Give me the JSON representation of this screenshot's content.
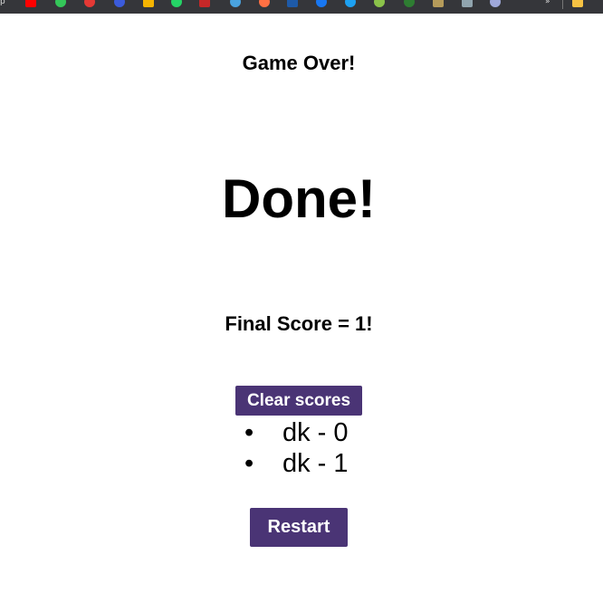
{
  "browser": {
    "bookmarks": [
      {
        "icon": "youtube-icon",
        "color": "#ff0000"
      },
      {
        "icon": "bookmark-green-icon",
        "color": "#34c759"
      },
      {
        "icon": "bookmark-red-icon",
        "color": "#e53935"
      },
      {
        "icon": "bookmark-blue-icon",
        "color": "#3b5bdb"
      },
      {
        "icon": "bookmark-yellow-icon",
        "color": "#f5b400"
      },
      {
        "icon": "whatsapp-icon",
        "color": "#25d366"
      },
      {
        "icon": "sk-icon",
        "color": "#c62828"
      },
      {
        "icon": "bookmark-lightblue-icon",
        "color": "#4aa3df"
      },
      {
        "icon": "bookmark-orange-icon",
        "color": "#ff7043"
      },
      {
        "icon": "bookmark-darkblue-icon",
        "color": "#1e5aa8"
      },
      {
        "icon": "facebook-icon",
        "color": "#1877f2"
      },
      {
        "icon": "twitter-icon",
        "color": "#1da1f2"
      },
      {
        "icon": "bookmark-lime-icon",
        "color": "#8bc34a"
      },
      {
        "icon": "shield-icon",
        "color": "#2e7d32"
      },
      {
        "icon": "chart-icon",
        "color": "#b59b5a"
      },
      {
        "icon": "bookmark-grey-icon",
        "color": "#90a4ae"
      },
      {
        "icon": "bookmark-purple-icon",
        "color": "#9fa8da"
      },
      {
        "icon": "folder-icon",
        "color": "#f6c243"
      }
    ],
    "overflow_label": "»"
  },
  "game": {
    "status_title": "Game Over!",
    "headline": "Done!",
    "final_score": "Final Score = 1!"
  },
  "scores": {
    "clear_label": "Clear scores",
    "items": [
      {
        "text": "dk - 0"
      },
      {
        "text": "dk - 1"
      }
    ]
  },
  "actions": {
    "restart_label": "Restart"
  },
  "theme": {
    "button_color": "#4a3475",
    "bar_color": "#35363a"
  }
}
